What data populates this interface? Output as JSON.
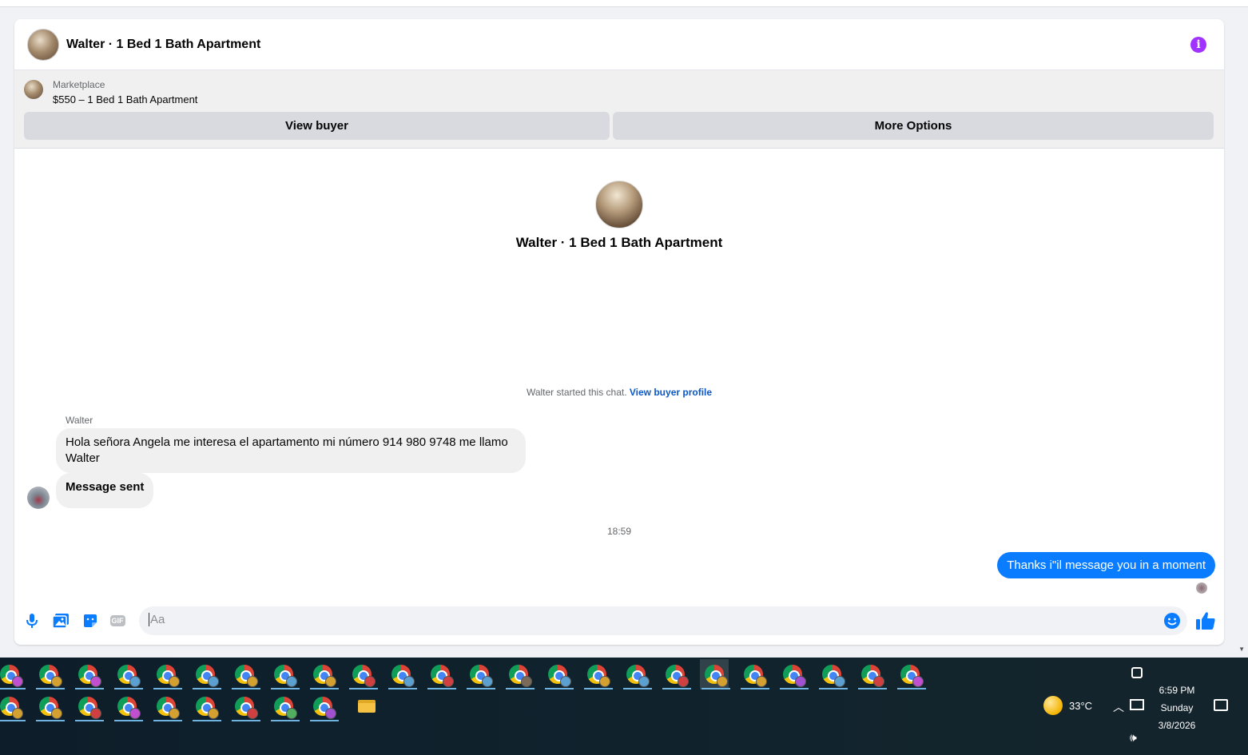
{
  "header": {
    "title": "Walter · 1 Bed 1 Bath Apartment"
  },
  "listing": {
    "source": "Marketplace",
    "price_title": "$550 – 1 Bed 1 Bath Apartment",
    "view_buyer_label": "View buyer",
    "more_options_label": "More Options"
  },
  "thread": {
    "title": "Walter · 1 Bed 1 Bath Apartment",
    "started_text": "Walter started this chat.",
    "started_link": "View buyer profile",
    "sender_name": "Walter",
    "incoming_message": "Hola señora Angela me interesa el apartamento mi número 914 980 9748 me llamo Walter",
    "sent_notice": "Message sent",
    "timestamp": "18:59",
    "outgoing_message": "Thanks i\"il message you in a moment"
  },
  "composer": {
    "placeholder": "Aa",
    "gif_label": "GIF"
  },
  "taskbar": {
    "weather_temp": "33°C",
    "clock_time": "6:59 PM",
    "clock_day": "Sunday",
    "clock_date": "3/8/2026",
    "row1_badges": [
      "#c050d0",
      "#d4a030",
      "#c050d0",
      "#5aa0d0",
      "#d4a030",
      "#5aa0d0",
      "#d4a030",
      "#5aa0d0",
      "#d4a030",
      "#d04040",
      "#5aa0d0",
      "#d04040",
      "#5aa0d0",
      "#7a6a5a",
      "#5aa0d0",
      "#d4a030",
      "#5aa0d0",
      "#d04040",
      "#d4a030",
      "#d4a030",
      "#a050d0",
      "#5aa0d0",
      "#d04040",
      "#c050d0"
    ],
    "row2_badges": [
      "#d4a030",
      "#d4a030",
      "#d04040",
      "#c050d0",
      "#d4a030",
      "#d4a030",
      "#d04040",
      "#50b060",
      "#a050d0"
    ]
  },
  "colors": {
    "accent_blue": "#0a7cff",
    "info_purple": "#a033ff",
    "link_blue": "#0a58ca"
  }
}
